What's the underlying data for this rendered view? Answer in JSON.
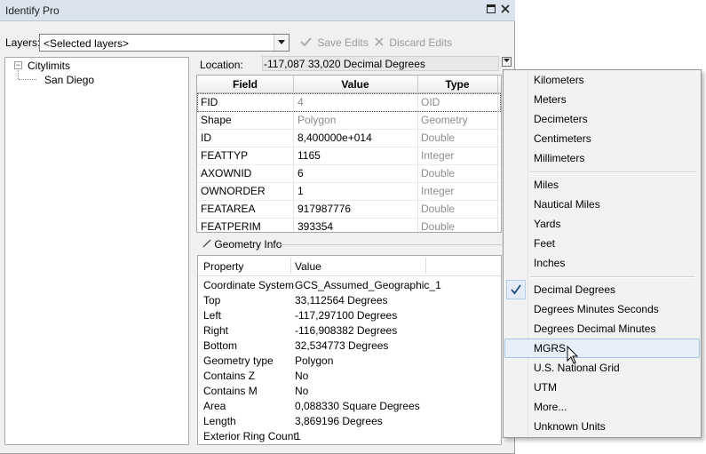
{
  "window": {
    "title": "Identify Pro"
  },
  "toolbar": {
    "layers_label": "Layers:",
    "layers_value": "<Selected layers>",
    "save_label": "Save Edits",
    "discard_label": "Discard Edits"
  },
  "tree": {
    "root": "Citylimits",
    "child": "San Diego"
  },
  "location": {
    "label": "Location:",
    "value": "-117,087  33,020 Decimal Degrees"
  },
  "grid": {
    "headers": [
      "Field",
      "Value",
      "Type"
    ],
    "rows": [
      {
        "field": "FID",
        "value": "4",
        "type": "OID"
      },
      {
        "field": "Shape",
        "value": "Polygon",
        "type": "Geometry"
      },
      {
        "field": "ID",
        "value": "8,400000e+014",
        "type": "Double"
      },
      {
        "field": "FEATTYP",
        "value": "1165",
        "type": "Integer"
      },
      {
        "field": "AXOWNID",
        "value": "6",
        "type": "Double"
      },
      {
        "field": "OWNORDER",
        "value": "1",
        "type": "Integer"
      },
      {
        "field": "FEATAREA",
        "value": "917987776",
        "type": "Double"
      },
      {
        "field": "FEATPERIM",
        "value": "393354",
        "type": "Double"
      }
    ]
  },
  "geometry": {
    "title": "Geometry Info",
    "headers": [
      "Property",
      "Value"
    ],
    "rows": [
      {
        "p": "Coordinate System",
        "v": "GCS_Assumed_Geographic_1"
      },
      {
        "p": "Top",
        "v": "33,112564 Degrees"
      },
      {
        "p": "Left",
        "v": "-117,297100 Degrees"
      },
      {
        "p": "Right",
        "v": "-116,908382 Degrees"
      },
      {
        "p": "Bottom",
        "v": "32,534773 Degrees"
      },
      {
        "p": "Geometry type",
        "v": "Polygon"
      },
      {
        "p": "Contains Z",
        "v": "No"
      },
      {
        "p": "Contains M",
        "v": "No"
      },
      {
        "p": "Area",
        "v": "0,088330 Square Degrees"
      },
      {
        "p": "Length",
        "v": "3,869196 Degrees"
      },
      {
        "p": "Exterior Ring Count",
        "v": "1"
      }
    ]
  },
  "menu": {
    "group1": [
      "Kilometers",
      "Meters",
      "Decimeters",
      "Centimeters",
      "Millimeters"
    ],
    "group2": [
      "Miles",
      "Nautical Miles",
      "Yards",
      "Feet",
      "Inches"
    ],
    "group3": [
      "Decimal Degrees",
      "Degrees Minutes Seconds",
      "Degrees Decimal Minutes",
      "MGRS",
      "U.S. National Grid",
      "UTM",
      "More...",
      "Unknown Units"
    ],
    "checked": "Decimal Degrees",
    "hovered": "MGRS"
  },
  "icons": {
    "check": "check-icon",
    "save": "checkmark-icon",
    "discard": "x-icon",
    "close": "close-icon",
    "restore": "restore-icon",
    "dropdown": "chevron-down-icon"
  }
}
